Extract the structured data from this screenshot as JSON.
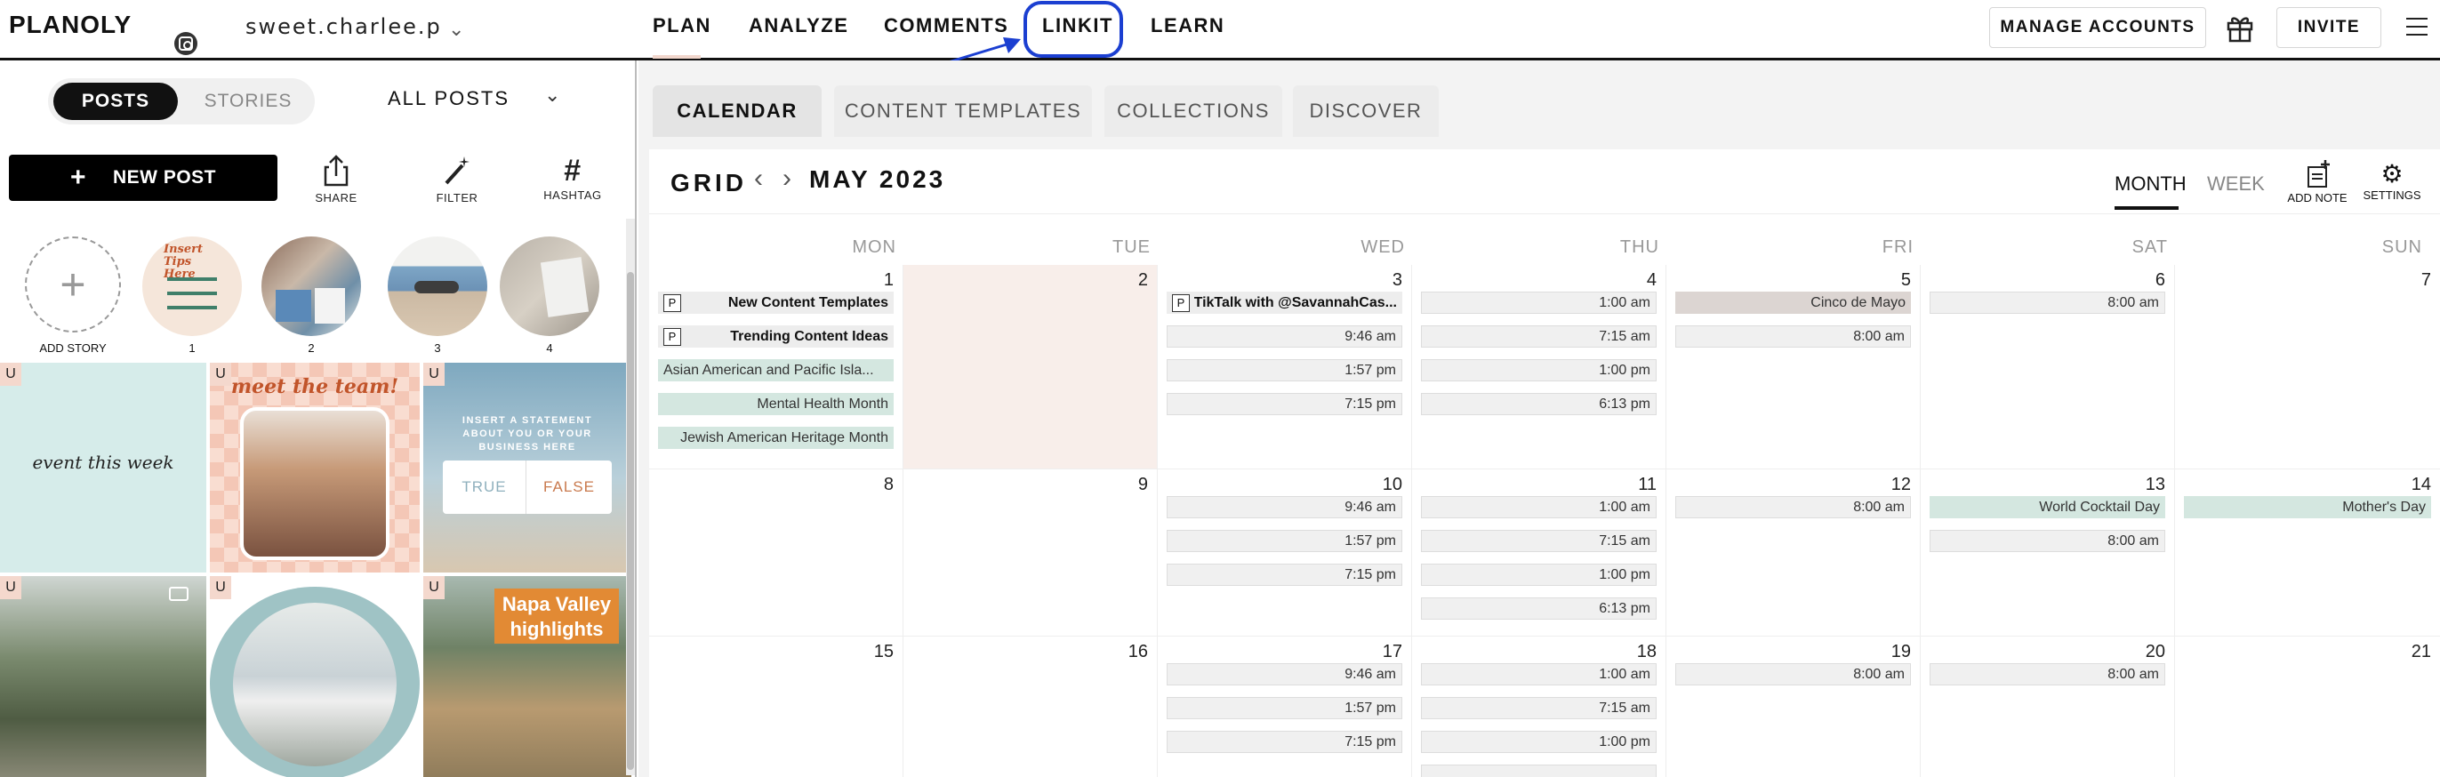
{
  "header": {
    "logo": "PLANOLY",
    "account_name": "sweet.charlee.p",
    "nav": [
      "PLAN",
      "ANALYZE",
      "COMMENTS",
      "LINKIT",
      "LEARN"
    ],
    "manage_accounts": "MANAGE ACCOUNTS",
    "invite": "INVITE"
  },
  "left": {
    "toggle": {
      "posts": "POSTS",
      "stories": "STORIES"
    },
    "filter_select": "ALL POSTS",
    "new_post": "NEW POST",
    "tools": [
      "SHARE",
      "FILTER",
      "HASHTAG"
    ],
    "add_story": "ADD STORY",
    "stories": [
      "1",
      "2",
      "3",
      "4"
    ],
    "story1_text": "Insert Tips Here",
    "badge": "U",
    "tile_event": "event this week",
    "tile_team": "meet the team!",
    "tile_statement": "INSERT A STATEMENT ABOUT YOU OR YOUR BUSINESS HERE",
    "tile_true": "TRUE",
    "tile_false": "FALSE",
    "tile_napa": "Napa Valley highlights"
  },
  "calendar": {
    "subtabs": [
      "CALENDAR",
      "CONTENT TEMPLATES",
      "COLLECTIONS",
      "DISCOVER"
    ],
    "title": "GRID",
    "month": "MAY 2023",
    "views": [
      "MONTH",
      "WEEK"
    ],
    "tools": [
      "ADD NOTE",
      "SETTINGS"
    ],
    "weekdays": [
      "MON",
      "TUE",
      "WED",
      "THU",
      "FRI",
      "SAT",
      "SUN"
    ],
    "days": {
      "d1": "1",
      "d2": "2",
      "d3": "3",
      "d4": "4",
      "d5": "5",
      "d6": "6",
      "d7": "7",
      "d8": "8",
      "d9": "9",
      "d10": "10",
      "d11": "11",
      "d12": "12",
      "d13": "13",
      "d14": "14",
      "d15": "15",
      "d16": "16",
      "d17": "17",
      "d18": "18",
      "d19": "19",
      "d20": "20",
      "d21": "21"
    },
    "note_badge": "P",
    "events": {
      "mon1_note1": "New Content Templates",
      "mon1_note2": "Trending Content Ideas",
      "mon1_hol1": "Asian American and Pacific Isla...",
      "mon1_hol2": "Mental Health Month",
      "mon1_hol3": "Jewish American Heritage Month",
      "wed3_note": "TikTalk with @SavannahCas...",
      "wed3_t1": "9:46 am",
      "wed3_t2": "1:57 pm",
      "wed3_t3": "7:15 pm",
      "thu4_t1": "1:00 am",
      "thu4_t2": "7:15 am",
      "thu4_t3": "1:00 pm",
      "thu4_t4": "6:13 pm",
      "fri5_hol": "Cinco de Mayo",
      "fri5_t1": "8:00 am",
      "sat6_t1": "8:00 am",
      "wed10_t1": "9:46 am",
      "wed10_t2": "1:57 pm",
      "wed10_t3": "7:15 pm",
      "thu11_t1": "1:00 am",
      "thu11_t2": "7:15 am",
      "thu11_t3": "1:00 pm",
      "thu11_t4": "6:13 pm",
      "fri12_t1": "8:00 am",
      "sat13_hol": "World Cocktail Day",
      "sat13_t1": "8:00 am",
      "sun14_hol": "Mother's Day",
      "wed17_t1": "9:46 am",
      "wed17_t2": "1:57 pm",
      "wed17_t3": "7:15 pm",
      "thu18_t1": "1:00 am",
      "thu18_t2": "7:15 am",
      "thu18_t3": "1:00 pm",
      "fri19_t1": "8:00 am",
      "sat20_t1": "8:00 am"
    }
  },
  "colors": {
    "accent_blue": "#1b3fd1",
    "holiday": "#d4e7e0",
    "highlight_day": "#f8eeea",
    "badge": "#f4d8cd"
  }
}
